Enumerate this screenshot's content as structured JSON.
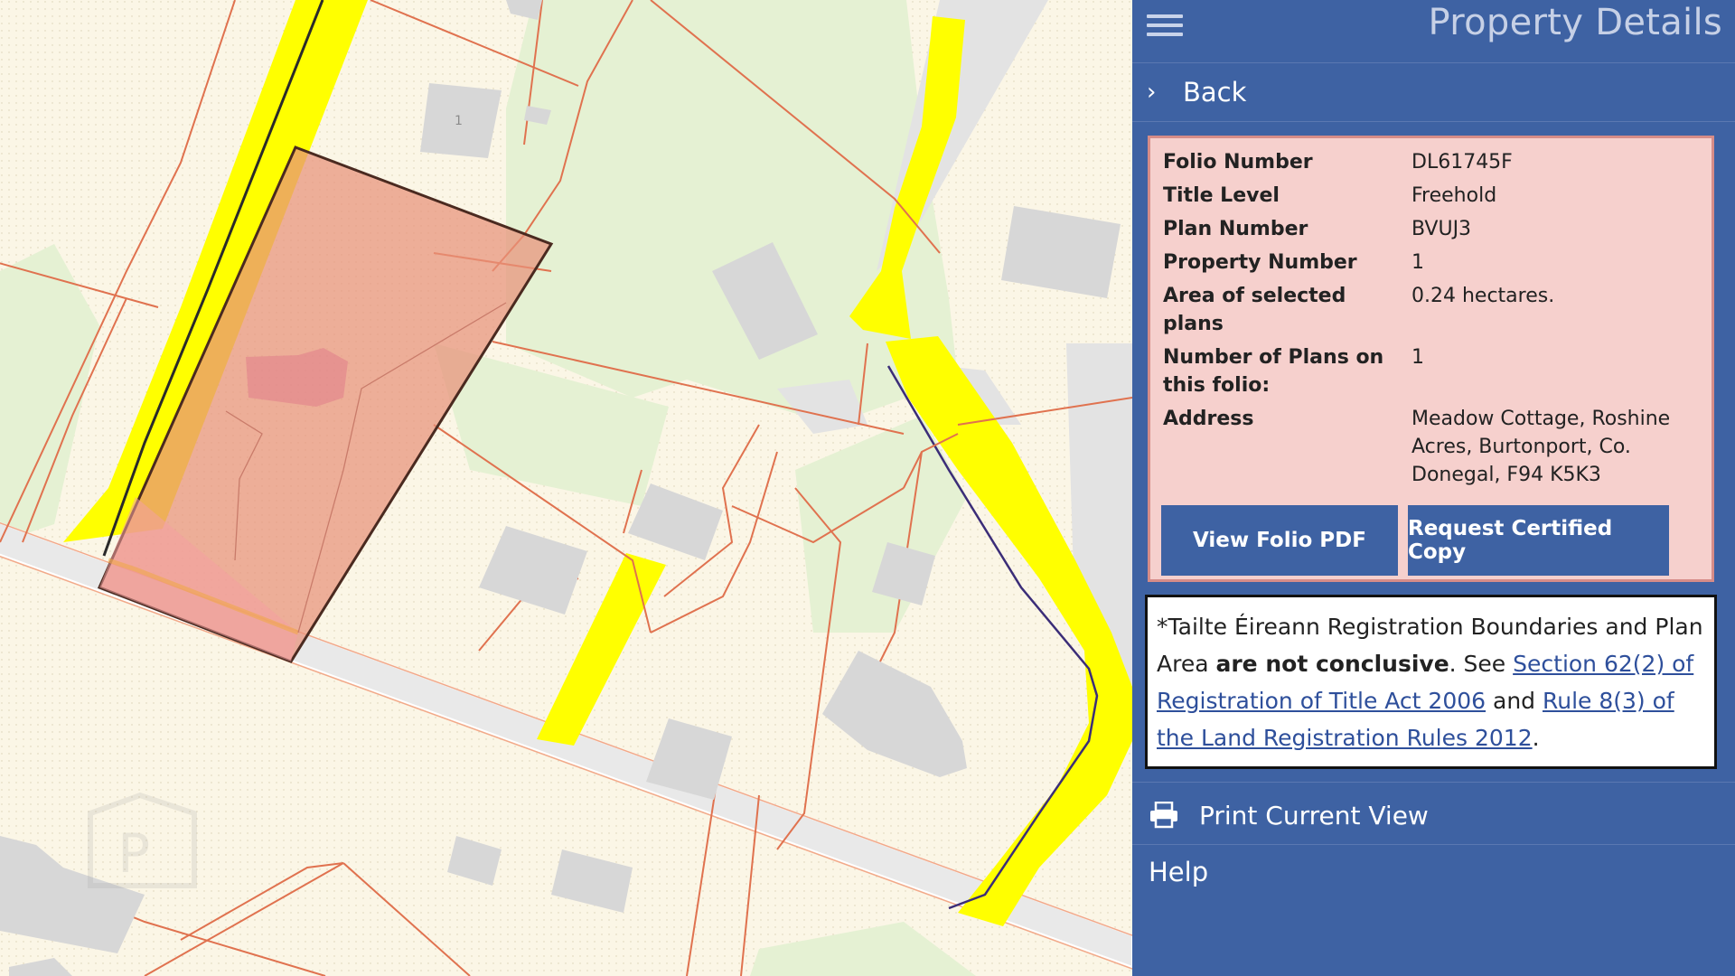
{
  "header": {
    "title": "Property Details",
    "menu_icon": "hamburger-menu-icon"
  },
  "nav": {
    "back_label": "Back",
    "back_icon": "chevron-right-icon"
  },
  "property": {
    "rows": [
      {
        "label": "Folio Number",
        "value": "DL61745F"
      },
      {
        "label": "Title Level",
        "value": "Freehold"
      },
      {
        "label": "Plan Number",
        "value": "BVUJ3"
      },
      {
        "label": "Property Number",
        "value": "1"
      },
      {
        "label": "Area of selected plans",
        "value": "0.24 hectares."
      },
      {
        "label": "Number of Plans on this folio:",
        "value": "1"
      },
      {
        "label": "Address",
        "value": "Meadow Cottage, Roshine Acres, Burtonport, Co. Donegal, F94 K5K3"
      }
    ],
    "buttons": {
      "view_pdf": "View Folio PDF",
      "request_copy": "Request Certified Copy"
    }
  },
  "notice": {
    "prefix": "*Tailte Éireann Registration Boundaries and Plan Area ",
    "bold": "are not conclusive",
    "middle": ". See ",
    "link1": "Section 62(2) of Registration of Title Act 2006",
    "and": " and ",
    "link2": "Rule 8(3) of the Land Registration Rules 2012",
    "suffix": "."
  },
  "menu": {
    "print_label": "Print Current View",
    "print_icon": "printer-icon",
    "help_label": "Help"
  },
  "map": {
    "plot_label": "1",
    "watermark_letter": "P"
  },
  "colors": {
    "panel": "#3e62a3",
    "selection_fill": "#e8927a",
    "road": "#ffff00",
    "boundary": "#e0724f",
    "info_bg": "#f6d0cd"
  }
}
